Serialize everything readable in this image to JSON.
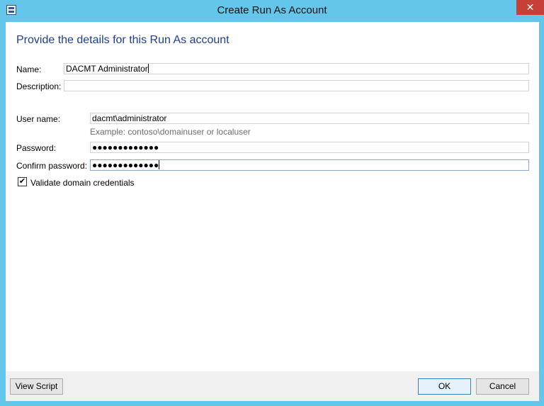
{
  "window": {
    "title": "Create Run As Account",
    "close_label": "✕"
  },
  "form": {
    "heading": "Provide the details for this Run As account",
    "name": {
      "label": "Name:",
      "value": "DACMT Administrator"
    },
    "description": {
      "label": "Description:",
      "value": ""
    },
    "username": {
      "label": "User name:",
      "value": "dacmt\\administrator",
      "hint": "Example: contoso\\domainuser or localuser"
    },
    "password": {
      "label": "Password:",
      "value": "●●●●●●●●●●●●●"
    },
    "confirm_password": {
      "label": "Confirm password:",
      "value": "●●●●●●●●●●●●●"
    },
    "validate": {
      "label": "Validate domain credentials",
      "checked": true,
      "check_glyph": "✔"
    }
  },
  "footer": {
    "view_script_label": "View Script",
    "ok_label": "OK",
    "cancel_label": "Cancel"
  }
}
